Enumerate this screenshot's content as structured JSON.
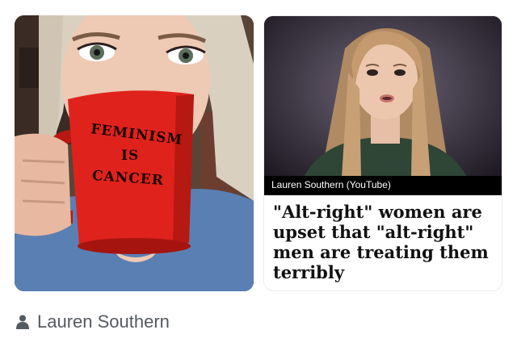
{
  "left_photo": {
    "mug_text": [
      "FEMINISM",
      "IS",
      "CANCER"
    ],
    "colors": {
      "mug": "#e0221c",
      "shirt": "#5a7fb3",
      "hair": "#d8cfc0"
    }
  },
  "right_card": {
    "video_caption": "Lauren Southern (YouTube)",
    "headline": "\"Alt-right\" women are upset that \"alt-right\" men are treating them terribly"
  },
  "author": {
    "icon": "person-icon",
    "name": "Lauren Southern"
  }
}
